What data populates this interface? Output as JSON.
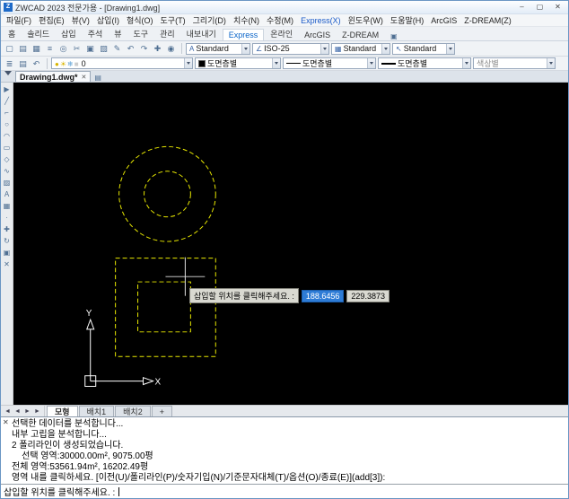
{
  "window": {
    "logo": "Z",
    "title": "ZWCAD 2023 전문가용 - [Drawing1.dwg]",
    "controls": {
      "minimize": "–",
      "maximize": "▢",
      "close": "✕"
    }
  },
  "icons": {
    "close": "✕",
    "new_doc": "▤",
    "ribbon_panel": "▣"
  },
  "menubar": [
    "파일(F)",
    "편집(E)",
    "뷰(V)",
    "삽입(I)",
    "형식(O)",
    "도구(T)",
    "그리기(D)",
    "치수(N)",
    "수정(M)",
    {
      "label": "Express(X)",
      "color": "#1a5ac8",
      "name": "menu-item-express"
    },
    "윈도우(W)",
    "도움말(H)",
    "ArcGIS",
    "Z-DREAM(Z)"
  ],
  "ribbon_tabs": [
    {
      "label": "홈"
    },
    {
      "label": "솔리드"
    },
    {
      "label": "삽입"
    },
    {
      "label": "주석"
    },
    {
      "label": "뷰"
    },
    {
      "label": "도구"
    },
    {
      "label": "관리"
    },
    {
      "label": "내보내기"
    },
    {
      "label": "Express",
      "active": true,
      "name": "ribbon-tab-express"
    },
    {
      "label": "온라인"
    },
    {
      "label": "ArcGIS"
    },
    {
      "label": "Z-DREAM"
    }
  ],
  "toolbar1": {
    "icons": [
      {
        "name": "new-icon",
        "glyph": "▢"
      },
      {
        "name": "open-icon",
        "glyph": "▤"
      },
      {
        "name": "save-icon",
        "glyph": "▦"
      },
      {
        "name": "plot-icon",
        "glyph": "≡"
      },
      {
        "name": "preview-icon",
        "glyph": "◎"
      },
      {
        "name": "cut-icon",
        "glyph": "✂"
      },
      {
        "name": "copy-icon",
        "glyph": "▣"
      },
      {
        "name": "paste-icon",
        "glyph": "▧"
      },
      {
        "name": "match-properties-icon",
        "glyph": "✎"
      },
      {
        "name": "undo-icon",
        "glyph": "↶"
      },
      {
        "name": "redo-icon",
        "glyph": "↷"
      },
      {
        "name": "pan-icon",
        "glyph": "✚"
      },
      {
        "name": "zoom-icon",
        "glyph": "◉"
      }
    ],
    "combos": [
      {
        "icon": "A",
        "value": "Standard"
      },
      {
        "icon": "∠",
        "value": "ISO-25"
      },
      {
        "icon": "▦",
        "value": "Standard"
      },
      {
        "icon": "↖",
        "value": "Standard"
      }
    ]
  },
  "toolbar2": {
    "icons": [
      {
        "name": "layer-properties-icon",
        "glyph": "≣"
      },
      {
        "name": "layer-states-icon",
        "glyph": "▤"
      },
      {
        "name": "layer-previous-icon",
        "glyph": "↶"
      }
    ],
    "layer": {
      "status_icons": [
        {
          "name": "layer-on-icon",
          "glyph": "●",
          "color": "#d8b400"
        },
        {
          "name": "layer-thaw-icon",
          "glyph": "☀",
          "color": "#d8b400"
        },
        {
          "name": "layer-freeze-icon",
          "glyph": "❄",
          "color": "#5a9fd4"
        },
        {
          "name": "layer-color-icon",
          "glyph": "■",
          "color": "#cccccc"
        }
      ],
      "value": "0"
    },
    "color": "도면층별",
    "linetype": "도면층별",
    "lineweight": "도면층별",
    "plot_style": "색상별"
  },
  "doc_tab": {
    "label": "Drawing1.dwg*"
  },
  "left_toolbar": [
    {
      "name": "select-icon",
      "glyph": "▶"
    },
    {
      "name": "line-icon",
      "glyph": "╱"
    },
    {
      "name": "polyline-icon",
      "glyph": "⌐"
    },
    {
      "name": "circle-icon",
      "glyph": "○"
    },
    {
      "name": "arc-icon",
      "glyph": "◠"
    },
    {
      "name": "rectangle-icon",
      "glyph": "▭"
    },
    {
      "name": "polygon-icon",
      "glyph": "◇"
    },
    {
      "name": "spline-icon",
      "glyph": "∿"
    },
    {
      "name": "hatch-icon",
      "glyph": "▨"
    },
    {
      "name": "text-icon",
      "glyph": "A"
    },
    {
      "name": "table-icon",
      "glyph": "▦"
    },
    {
      "name": "point-icon",
      "glyph": "·"
    },
    {
      "name": "move-icon",
      "glyph": "✚"
    },
    {
      "name": "rotate-icon",
      "glyph": "↻"
    },
    {
      "name": "copy-icon",
      "glyph": "▣"
    },
    {
      "name": "erase-icon",
      "glyph": "✕"
    }
  ],
  "canvas": {
    "tooltip": {
      "label": "삽입할 위치를 클릭해주세요. :",
      "x_value": "188.6456",
      "y_value": "229.3873"
    },
    "ucs": {
      "x_label": "X",
      "y_label": "Y"
    },
    "accent_color": "#e8e800"
  },
  "layout": {
    "nav_icons": [
      {
        "name": "first-layout-icon",
        "glyph": "◄"
      },
      {
        "name": "prev-layout-icon",
        "glyph": "◄"
      },
      {
        "name": "next-layout-icon",
        "glyph": "►"
      },
      {
        "name": "last-layout-icon",
        "glyph": "►"
      }
    ],
    "tabs": [
      {
        "label": "모형",
        "active": true,
        "name": "layout-tab-model"
      },
      {
        "label": "배치1",
        "name": "layout-tab-layout1"
      },
      {
        "label": "배치2",
        "name": "layout-tab-layout2"
      },
      {
        "label": "+",
        "name": "layout-tab-add"
      }
    ]
  },
  "command": {
    "history": [
      "선택한 데이터를 분석합니다...",
      "내부 고립을 분석합니다...",
      "2 폴리라인이 생성되었습니다.",
      "    선택 영역:30000.00m², 9075.00평",
      "전체 영역:53561.94m², 16202.49평",
      "영역 내를 클릭하세요. [이전(U)/폴리라인(P)/숫자기입(N)/기준문자대체(T)/옵션(O)/종료(E)](add[3]):"
    ],
    "prompt": "삽입할 위치를 클릭해주세요. : "
  }
}
